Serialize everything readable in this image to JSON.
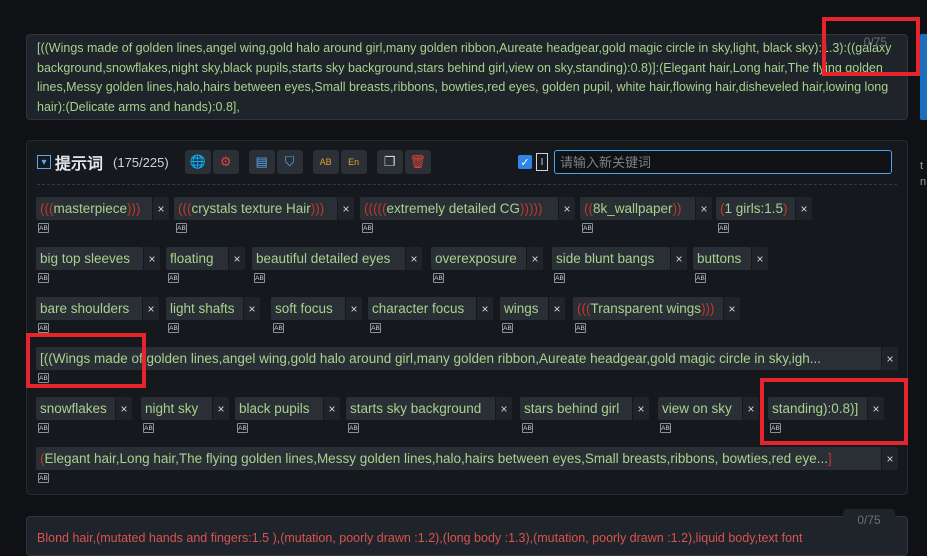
{
  "prompt": {
    "text": "[((Wings made of golden lines,angel wing,gold halo around girl,many golden ribbon,Aureate headgear,gold magic circle in sky,light, black sky):1.3):((galaxy background,snowflakes,night sky,black pupils,starts sky background,stars behind girl,view on sky,standing):0.8)]:(Elegant hair,Long hair,The flying golden lines,Messy golden lines,halo,hairs between eyes,Small breasts,ribbons, bowties,red eyes, golden pupil, white hair,flowing hair,disheveled hair,lowing long hair):(Delicate arms and hands):0.8],",
    "count": "0/75"
  },
  "panel": {
    "title": "提示词",
    "count": "(175/225)",
    "placeholder": "请输入新关键词",
    "checkbox_checked": true
  },
  "toolbar_icons": [
    "globe-icon",
    "gear-icon",
    "import-icon",
    "bookmark-icon",
    "translate-ab-icon",
    "translate-en-icon",
    "copy-icon",
    "trash-icon"
  ],
  "tags": [
    {
      "open": "(((",
      "text": "masterpiece",
      "close": ")))"
    },
    {
      "open": "(((",
      "text": "crystals texture Hair",
      "close": ")))"
    },
    {
      "open": "(((((",
      "text": "extremely detailed CG",
      "close": ")))))"
    },
    {
      "open": "((",
      "text": "8k_wallpaper",
      "close": "))"
    },
    {
      "open": "(",
      "text": "1 girls:1.5",
      "close": ")"
    },
    {
      "open": "",
      "text": "big top sleeves",
      "close": ""
    },
    {
      "open": "",
      "text": "floating",
      "close": ""
    },
    {
      "open": "",
      "text": "beautiful detailed eyes",
      "close": ""
    },
    {
      "open": "",
      "text": "overexposure",
      "close": ""
    },
    {
      "open": "",
      "text": "side blunt bangs",
      "close": ""
    },
    {
      "open": "",
      "text": "buttons",
      "close": ""
    },
    {
      "open": "",
      "text": "bare shoulders",
      "close": ""
    },
    {
      "open": "",
      "text": "light shafts",
      "close": ""
    },
    {
      "open": "",
      "text": "soft focus",
      "close": ""
    },
    {
      "open": "",
      "text": "character focus",
      "close": ""
    },
    {
      "open": "",
      "text": "wings",
      "close": ""
    },
    {
      "open": "(((",
      "text": "Transparent wings",
      "close": ")))"
    },
    {
      "open": "",
      "text": "[((Wings made of golden lines,angel wing,gold halo around girl,many golden ribbon,Aureate headgear,gold magic circle in sky,igh...",
      "close": ""
    },
    {
      "open": "",
      "text": "snowflakes",
      "close": ""
    },
    {
      "open": "",
      "text": "night sky",
      "close": ""
    },
    {
      "open": "",
      "text": "black pupils",
      "close": ""
    },
    {
      "open": "",
      "text": "starts sky background",
      "close": ""
    },
    {
      "open": "",
      "text": "stars behind girl",
      "close": ""
    },
    {
      "open": "",
      "text": "view on sky",
      "close": ""
    },
    {
      "open": "",
      "text": "standing):0.8)]",
      "close": ""
    },
    {
      "open": "(",
      "text": "Elegant hair,Long hair,The flying golden lines,Messy golden lines,halo,hairs between eyes,Small breasts,ribbons, bowties,red eye...",
      "close": "]"
    }
  ],
  "negative": {
    "text": "Blond hair,(mutated hands and fingers:1.5 ),(mutation, poorly drawn :1.2),(long body :1.3),(mutation, poorly drawn :1.2),liquid body,text font",
    "count": "0/75"
  },
  "colors": {
    "tag_text": "#a9d18e",
    "bracket": "#c0392b",
    "highlight": "#e5242b",
    "accent": "#4aa3ee"
  }
}
